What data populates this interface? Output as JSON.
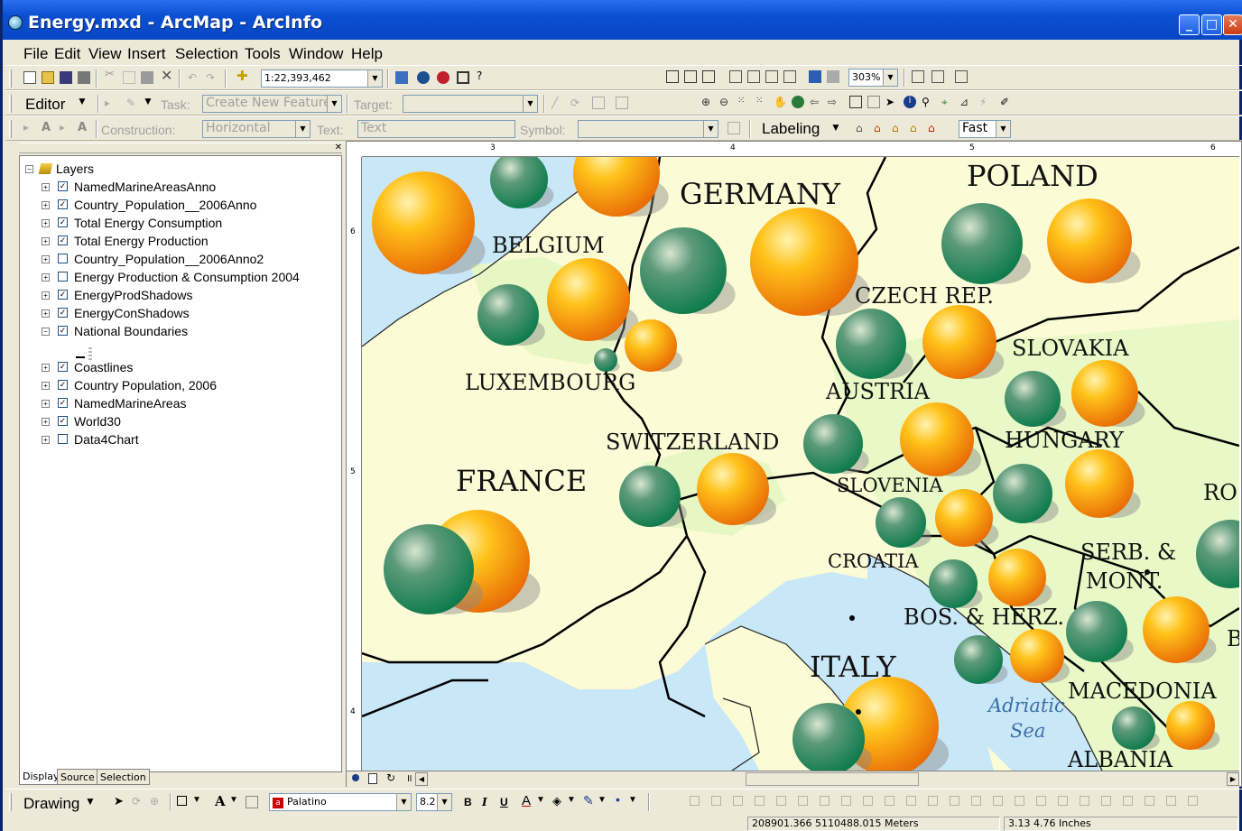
{
  "window": {
    "title": "Energy.mxd - ArcMap - ArcInfo"
  },
  "menu": [
    "File",
    "Edit",
    "View",
    "Insert",
    "Selection",
    "Tools",
    "Window",
    "Help"
  ],
  "standard_toolbar": {
    "scale_value": "1:22,393,462"
  },
  "layout_toolbar": {
    "zoom_value": "303%"
  },
  "editor_toolbar": {
    "editor_label": "Editor",
    "task_label": "Task:",
    "task_value": "Create New Feature",
    "target_label": "Target:",
    "target_value": ""
  },
  "construction_toolbar": {
    "construction_label": "Construction:",
    "construction_value": "Horizontal",
    "text_label": "Text:",
    "text_value": "Text",
    "symbol_label": "Symbol:",
    "symbol_value": ""
  },
  "labeling_toolbar": {
    "label": "Labeling",
    "quality_value": "Fast"
  },
  "toc": {
    "root": "Layers",
    "layers": [
      {
        "name": "NamedMarineAreasAnno",
        "checked": true
      },
      {
        "name": "Country_Population__2006Anno",
        "checked": true
      },
      {
        "name": "Total Energy Consumption",
        "checked": true
      },
      {
        "name": "Total Energy Production",
        "checked": true
      },
      {
        "name": "Country_Population__2006Anno2",
        "checked": false
      },
      {
        "name": "Energy Production & Consumption 2004",
        "checked": false
      },
      {
        "name": "EnergyProdShadows",
        "checked": true
      },
      {
        "name": "EnergyConShadows",
        "checked": true
      },
      {
        "name": "National Boundaries",
        "checked": true
      },
      {
        "name": "Coastlines",
        "checked": true
      },
      {
        "name": "Country Population, 2006",
        "checked": true
      },
      {
        "name": "NamedMarineAreas",
        "checked": true
      },
      {
        "name": "World30",
        "checked": true
      },
      {
        "name": "Data4Chart",
        "checked": false
      }
    ],
    "tabs": [
      "Display",
      "Source",
      "Selection"
    ]
  },
  "rulers": {
    "h_ticks": [
      "3",
      "4",
      "5",
      "6"
    ],
    "v_ticks": [
      "6",
      "5",
      "4"
    ]
  },
  "map": {
    "countries": {
      "germany": "GERMANY",
      "poland": "POLAND",
      "belgium": "BELGIUM",
      "czech": "CZECH REP.",
      "slovakia": "SLOVAKIA",
      "luxembourg": "LUXEMBOURG",
      "austria": "AUSTRIA",
      "switzerland": "SWITZERLAND",
      "hungary": "HUNGARY",
      "france": "FRANCE",
      "slovenia": "SLOVENIA",
      "romania": "RO",
      "croatia": "CROATIA",
      "serbia1": "SERB. &",
      "serbia2": "MONT.",
      "bosnia": "BOS. & HERZ.",
      "italy": "ITALY",
      "macedonia": "MACEDONIA",
      "albania": "ALBANIA",
      "b_partial": "B"
    },
    "sea_line1": "Adriatic",
    "sea_line2": "Sea",
    "colors": {
      "production": "#1f8a5c",
      "consumption": "#f59a0c",
      "land": "#fbfbd6",
      "water": "#c8e7f7",
      "land_green": "#e6f7c4"
    }
  },
  "drawing_toolbar": {
    "label": "Drawing",
    "font_value": "Palatino",
    "size_value": "8.2"
  },
  "status": {
    "coords": "208901.366  5110488.015 Meters",
    "page": "3.13  4.76 Inches"
  }
}
